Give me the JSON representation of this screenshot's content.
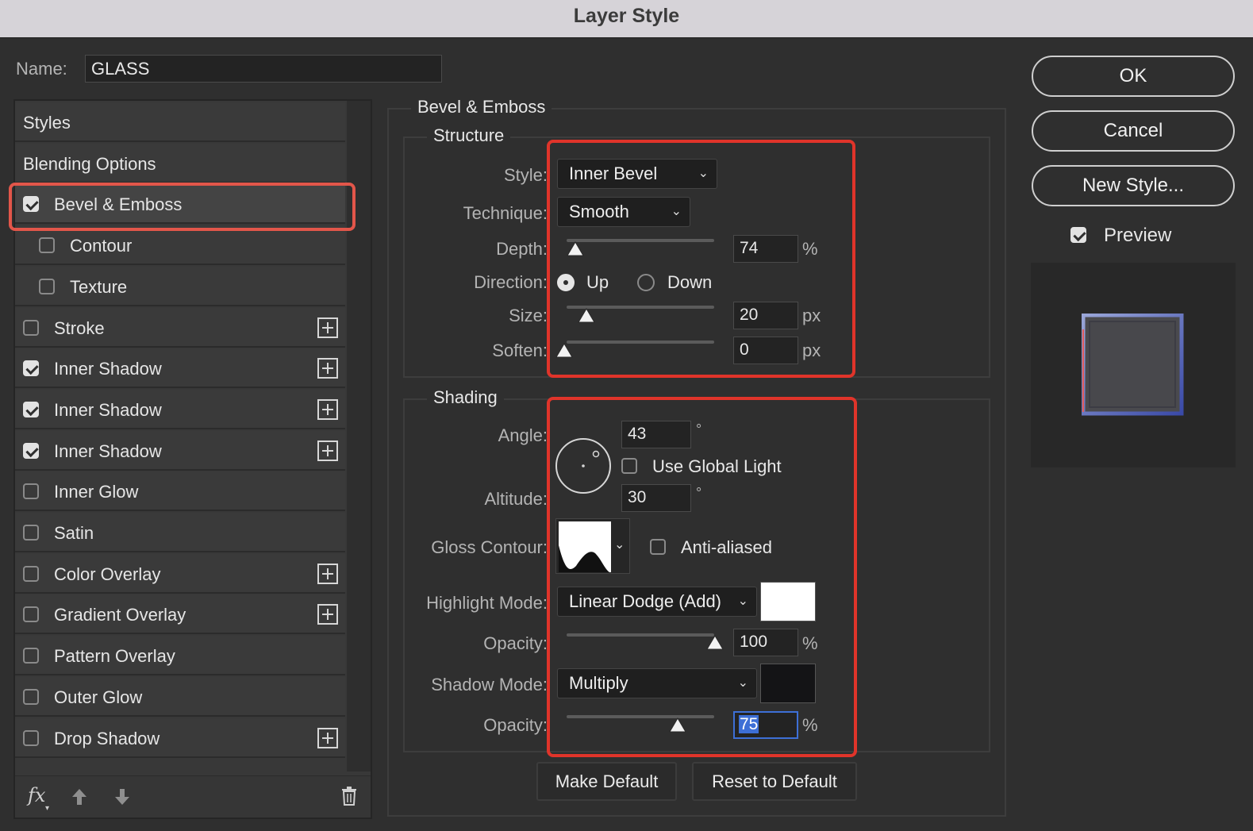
{
  "window": {
    "title": "Layer Style"
  },
  "name_field": {
    "label": "Name:",
    "value": "GLASS"
  },
  "sidebar": {
    "items": [
      {
        "label": "Styles"
      },
      {
        "label": "Blending Options"
      },
      {
        "label": "Bevel & Emboss",
        "checked": true,
        "selected": true
      },
      {
        "label": "Contour",
        "checked": false
      },
      {
        "label": "Texture",
        "checked": false
      },
      {
        "label": "Stroke",
        "checked": false,
        "has_add": true
      },
      {
        "label": "Inner Shadow",
        "checked": true,
        "has_add": true
      },
      {
        "label": "Inner Shadow",
        "checked": true,
        "has_add": true
      },
      {
        "label": "Inner Shadow",
        "checked": true,
        "has_add": true
      },
      {
        "label": "Inner Glow",
        "checked": false
      },
      {
        "label": "Satin",
        "checked": false
      },
      {
        "label": "Color Overlay",
        "checked": false,
        "has_add": true
      },
      {
        "label": "Gradient Overlay",
        "checked": false,
        "has_add": true
      },
      {
        "label": "Pattern Overlay",
        "checked": false
      },
      {
        "label": "Outer Glow",
        "checked": false
      },
      {
        "label": "Drop Shadow",
        "checked": false,
        "has_add": true
      }
    ],
    "footer": {
      "fx_label": "fx"
    }
  },
  "bevel": {
    "section_title": "Bevel & Emboss",
    "structure": {
      "title": "Structure",
      "style_label": "Style:",
      "style_value": "Inner Bevel",
      "technique_label": "Technique:",
      "technique_value": "Smooth",
      "depth_label": "Depth:",
      "depth_value": "74",
      "depth_unit": "%",
      "direction_label": "Direction:",
      "direction_up": "Up",
      "direction_down": "Down",
      "direction_selected": "Up",
      "size_label": "Size:",
      "size_value": "20",
      "size_unit": "px",
      "soften_label": "Soften:",
      "soften_value": "0",
      "soften_unit": "px"
    },
    "shading": {
      "title": "Shading",
      "angle_label": "Angle:",
      "angle_value": "43",
      "degree_symbol": "°",
      "use_global_light_label": "Use Global Light",
      "use_global_light": false,
      "altitude_label": "Altitude:",
      "altitude_value": "30",
      "gloss_contour_label": "Gloss Contour:",
      "anti_aliased_label": "Anti-aliased",
      "anti_aliased": false,
      "highlight_mode_label": "Highlight Mode:",
      "highlight_mode_value": "Linear Dodge (Add)",
      "highlight_color": "#ffffff",
      "highlight_opacity_label": "Opacity:",
      "highlight_opacity_value": "100",
      "highlight_opacity_unit": "%",
      "shadow_mode_label": "Shadow Mode:",
      "shadow_mode_value": "Multiply",
      "shadow_color": "#141416",
      "shadow_opacity_label": "Opacity:",
      "shadow_opacity_value": "75",
      "shadow_opacity_unit": "%"
    },
    "make_default_label": "Make Default",
    "reset_default_label": "Reset to Default"
  },
  "actions": {
    "ok_label": "OK",
    "cancel_label": "Cancel",
    "new_style_label": "New Style...",
    "preview_label": "Preview",
    "preview_checked": true
  },
  "colors": {
    "highlight_box": "#e0342a",
    "selection": "#3d6fd6"
  }
}
